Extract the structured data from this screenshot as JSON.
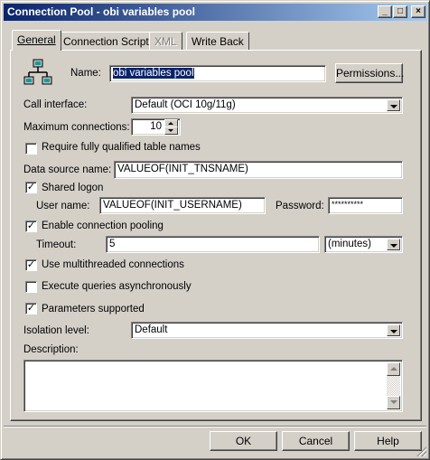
{
  "window": {
    "title": "Connection Pool - obi variables pool",
    "minimize_glyph": "_",
    "maximize_glyph": "□",
    "close_glyph": "×"
  },
  "tabs": [
    {
      "label": "General",
      "state": "active"
    },
    {
      "label": "Connection Scripts",
      "state": "normal"
    },
    {
      "label": "XML",
      "state": "disabled"
    },
    {
      "label": "Write Back",
      "state": "normal"
    }
  ],
  "general": {
    "icon": "network-icon",
    "name_label": "Name:",
    "name_value": "obi variables pool",
    "permissions_label": "Permissions...",
    "call_interface_label": "Call interface:",
    "call_interface_value": "Default (OCI 10g/11g)",
    "max_connections_label": "Maximum connections:",
    "max_connections_value": "10",
    "require_fq_label": "Require fully qualified table names",
    "require_fq_checked": false,
    "data_source_label": "Data source name:",
    "data_source_value": "VALUEOF(INIT_TNSNAME)",
    "shared_logon_label": "Shared logon",
    "shared_logon_checked": true,
    "user_name_label": "User name:",
    "user_name_value": "VALUEOF(INIT_USERNAME)",
    "password_label": "Password:",
    "password_value": "**********",
    "enable_pooling_label": "Enable connection pooling",
    "enable_pooling_checked": true,
    "timeout_label": "Timeout:",
    "timeout_value": "5",
    "timeout_unit": "(minutes)",
    "multithreaded_label": "Use multithreaded connections",
    "multithreaded_checked": true,
    "async_label": "Execute queries asynchronously",
    "async_checked": false,
    "params_label": "Parameters supported",
    "params_checked": true,
    "isolation_label": "Isolation level:",
    "isolation_value": "Default",
    "description_label": "Description:",
    "description_value": ""
  },
  "footer": {
    "ok_label": "OK",
    "cancel_label": "Cancel",
    "help_label": "Help"
  },
  "colors": {
    "titlebar_start": "#0a246a",
    "titlebar_end": "#a6caf0",
    "face": "#d4d0c8",
    "selection": "#0a246a"
  }
}
